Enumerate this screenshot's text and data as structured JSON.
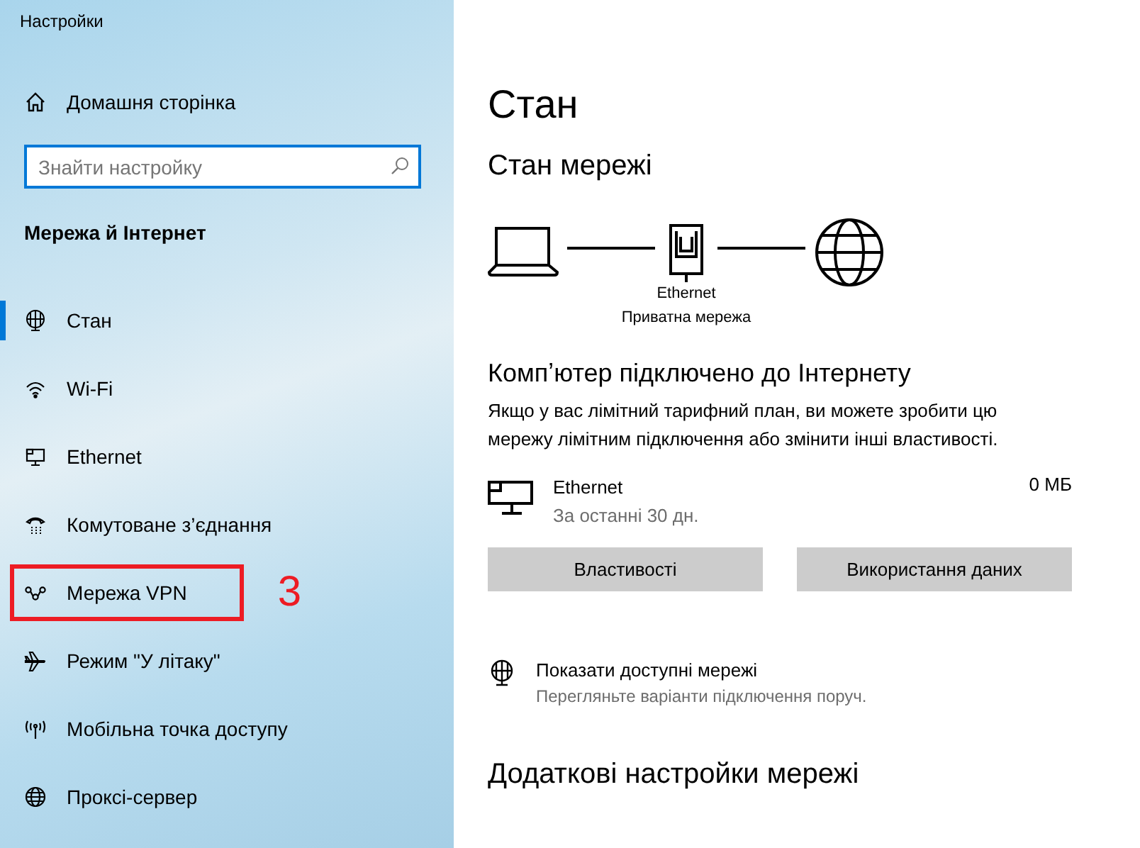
{
  "window": {
    "title": "Настройки"
  },
  "sidebar": {
    "home": {
      "label": "Домашня сторінка"
    },
    "search": {
      "placeholder": "Знайти настройку",
      "focused": true
    },
    "section": "Мережа й Інтернет",
    "items": [
      {
        "kind": "status",
        "label": "Стан",
        "selected": true,
        "highlighted": false
      },
      {
        "kind": "wifi",
        "label": "Wi-Fi",
        "selected": false,
        "highlighted": false
      },
      {
        "kind": "ethernet",
        "label": "Ethernet",
        "selected": false,
        "highlighted": false
      },
      {
        "kind": "dialup",
        "label": "Комутоване з’єднання",
        "selected": false,
        "highlighted": false
      },
      {
        "kind": "vpn",
        "label": "Мережа VPN",
        "selected": false,
        "highlighted": true,
        "annotation": "3"
      },
      {
        "kind": "airplane",
        "label": "Режим \"У літаку\"",
        "selected": false,
        "highlighted": false
      },
      {
        "kind": "hotspot",
        "label": "Мобільна точка доступу",
        "selected": false,
        "highlighted": false
      },
      {
        "kind": "proxy",
        "label": "Проксі-сервер",
        "selected": false,
        "highlighted": false
      }
    ]
  },
  "main": {
    "title": "Стан",
    "network_heading": "Стан мережі",
    "diagram": {
      "adapter": "Ethernet",
      "profile": "Приватна мережа"
    },
    "status_heading": "Компʼютер підключено до Інтернету",
    "status_text": "Якщо у вас лімітний тарифний план, ви можете зробити цю мережу лімітним підключення або змінити інші властивості.",
    "connection": {
      "name": "Ethernet",
      "period": "За останні 30 дн.",
      "usage": "0 МБ"
    },
    "buttons": [
      "Властивості",
      "Використання даних"
    ],
    "show_networks": {
      "title": "Показати доступні мережі",
      "subtitle": "Перегляньте варіанти підключення поруч."
    },
    "more_heading": "Додаткові настройки мережі"
  }
}
